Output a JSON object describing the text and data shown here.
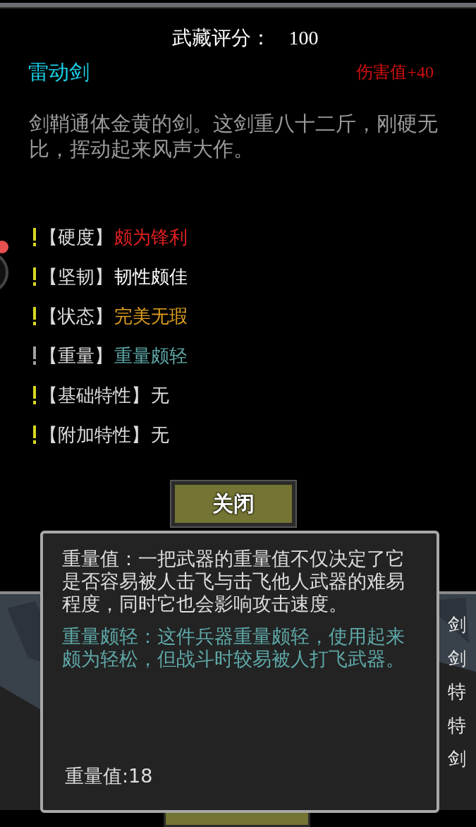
{
  "score": {
    "label": "武藏评分：",
    "value": "100"
  },
  "weapon": {
    "name": "雷动剑",
    "bonus": "伤害值+40",
    "description": "剑鞘通体金黄的剑。这剑重八十二斤，刚硬无比，挥动起来风声大作。"
  },
  "attributes": [
    {
      "label": "【硬度】",
      "value": "颇为锋利",
      "color": "#e02020",
      "highlighted": true
    },
    {
      "label": "【坚韧】",
      "value": "韧性颇佳",
      "color": "#ffffff",
      "highlighted": true
    },
    {
      "label": "【状态】",
      "value": "完美无瑕",
      "color": "#e0a020",
      "highlighted": true
    },
    {
      "label": "【重量】",
      "value": "重量颇轻",
      "color": "#5fa8a8",
      "highlighted": false
    },
    {
      "label": "【基础特性】",
      "value": "无",
      "color": "#e0e0e0",
      "highlighted": true
    },
    {
      "label": "【附加特性】",
      "value": "无",
      "color": "#e0e0e0",
      "highlighted": true
    }
  ],
  "close_button": "关闭",
  "background_list": [
    {
      "right": "剑"
    },
    {
      "right": "剑"
    },
    {
      "right": "特"
    },
    {
      "right": "特"
    },
    {
      "right": "剑"
    }
  ],
  "tooltip": {
    "text": "重量值：一把武器的重量值不仅决定了它是否容易被人击飞与击飞他人武器的难易程度，同时它也会影响攻击速度。",
    "detail": "重量颇轻：这件兵器重量颇轻，使用起来颇为轻松，但战斗时较易被人打飞武器。",
    "value": "重量值:18"
  }
}
